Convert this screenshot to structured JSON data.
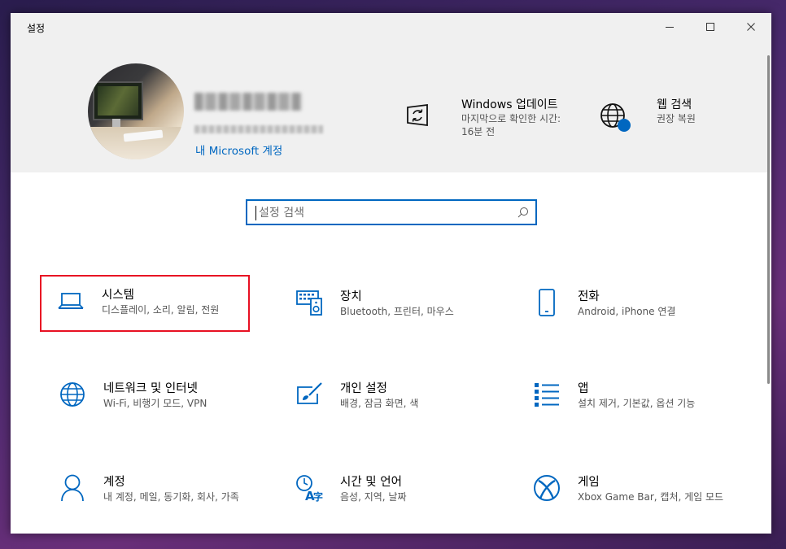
{
  "window": {
    "title": "설정"
  },
  "header": {
    "account_link": "내 Microsoft 계정",
    "windows_update": {
      "title": "Windows 업데이트",
      "subtitle": "마지막으로 확인한 시간: 16분 전"
    },
    "web_search": {
      "title": "웹 검색",
      "subtitle": "권장 복원"
    }
  },
  "search": {
    "placeholder": "설정 검색"
  },
  "colors": {
    "accent": "#0067c0",
    "selection": "#e81123",
    "header_bg": "#f0f0f0"
  },
  "tiles": [
    {
      "title": "시스템",
      "subtitle": "디스플레이, 소리, 알림, 전원",
      "icon": "laptop-icon"
    },
    {
      "title": "장치",
      "subtitle": "Bluetooth, 프린터, 마우스",
      "icon": "keyboard-device-icon"
    },
    {
      "title": "전화",
      "subtitle": "Android, iPhone 연결",
      "icon": "phone-icon"
    },
    {
      "title": "네트워크 및 인터넷",
      "subtitle": "Wi-Fi, 비행기 모드, VPN",
      "icon": "globe-icon"
    },
    {
      "title": "개인 설정",
      "subtitle": "배경, 잠금 화면, 색",
      "icon": "personalization-icon"
    },
    {
      "title": "앱",
      "subtitle": "설치 제거, 기본값, 옵션 기능",
      "icon": "apps-list-icon"
    },
    {
      "title": "계정",
      "subtitle": "내 계정, 메일, 동기화, 회사, 가족",
      "icon": "person-icon"
    },
    {
      "title": "시간 및 언어",
      "subtitle": "음성, 지역, 날짜",
      "icon": "time-language-icon"
    },
    {
      "title": "게임",
      "subtitle": "Xbox Game Bar, 캡처, 게임 모드",
      "icon": "xbox-icon"
    }
  ]
}
